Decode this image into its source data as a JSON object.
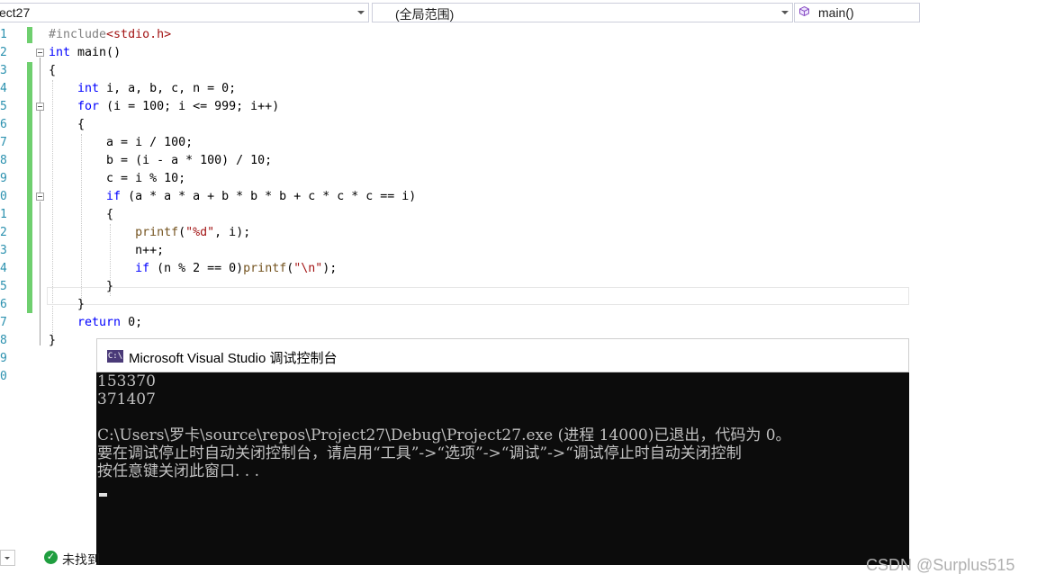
{
  "navbar": {
    "project": "ect27",
    "scope": "(全局范围)",
    "member": "main()"
  },
  "editor": {
    "line_numbers": [
      "1",
      "2",
      "3",
      "4",
      "5",
      "6",
      "7",
      "8",
      "9",
      "0",
      "1",
      "2",
      "3",
      "4",
      "5",
      "6",
      "7",
      "8",
      "9",
      "0"
    ],
    "code": [
      "#include<stdio.h>",
      "int main()",
      "{",
      "    int i, a, b, c, n = 0;",
      "    for (i = 100; i <= 999; i++)",
      "    {",
      "        a = i / 100;",
      "        b = (i - a * 100) / 10;",
      "        c = i % 10;",
      "        if (a * a * a + b * b * b + c * c * c == i)",
      "        {",
      "            printf(\"%d\", i);",
      "            n++;",
      "            if (n % 2 == 0)printf(\"\\n\");",
      "        }",
      "    }",
      "    return 0;",
      "}"
    ]
  },
  "console": {
    "icon": "C:\\",
    "title": "Microsoft Visual Studio 调试控制台",
    "lines": [
      "153370",
      "371407",
      "",
      "C:\\Users\\罗卡\\source\\repos\\Project27\\Debug\\Project27.exe (进程 14000)已退出，代码为 0。",
      "要在调试停止时自动关闭控制台，请启用“工具”->“选项”->“调试”->“调试停止时自动关闭控制",
      "按任意键关闭此窗口. . ."
    ]
  },
  "status": {
    "message": "未找到"
  },
  "watermark": "CSDN @Surplus515",
  "colors": {
    "keyword": "#0000ff",
    "preprocessor": "#808080",
    "string": "#a31515",
    "change_bar": "#6fcf6f",
    "console_bg": "#0c0c0c",
    "console_text": "#c0c0c0"
  }
}
